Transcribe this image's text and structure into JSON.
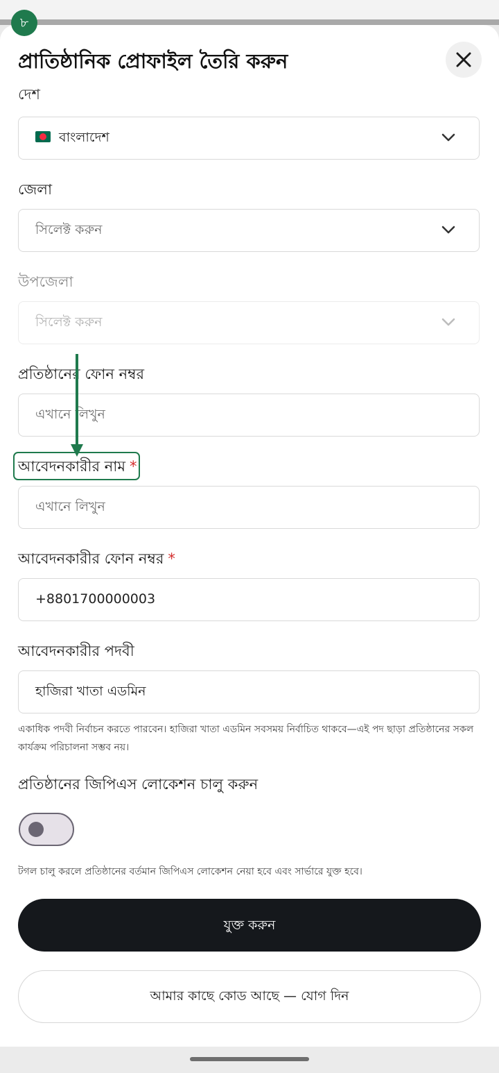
{
  "step_badge": "৮",
  "header": {
    "title": "প্রাতিষ্ঠানিক প্রোফাইল তৈরি করুন",
    "close_icon": "close-icon"
  },
  "country": {
    "clipped_label": "দেশ",
    "value": "বাংলাদেশ",
    "flag": "bangladesh-flag-icon"
  },
  "district": {
    "label": "জেলা",
    "placeholder": "সিলেক্ট করুন"
  },
  "upazila": {
    "label": "উপজেলা",
    "placeholder": "সিলেক্ট করুন"
  },
  "org_phone": {
    "label": "প্রতিষ্ঠানের ফোন নম্বর",
    "placeholder": "এখানে লিখুন"
  },
  "applicant_name": {
    "label": "আবেদনকারীর নাম",
    "required": "*",
    "placeholder": "এখানে লিখুন"
  },
  "applicant_phone": {
    "label": "আবেদনকারীর ফোন নম্বর",
    "required": "*",
    "value": "+8801700000003"
  },
  "applicant_designation": {
    "label": "আবেদনকারীর পদবী",
    "value": "হাজিরা খাতা এডমিন",
    "helper": "একাধিক পদবী নির্বাচন করতে পারবেন। হাজিরা খাতা এডমিন সবসময় নির্বাচিত থাকবে—এই পদ ছাড়া প্রতিষ্ঠানের সকল কার্যক্রম পরিচালনা সম্ভব নয়।"
  },
  "gps": {
    "label": "প্রতিষ্ঠানের জিপিএস লোকেশন চালু করুন",
    "enabled": false,
    "helper": "টগল চালু করলে প্রতিষ্ঠানের বর্তমান জিপিএস লোকেশন নেয়া হবে এবং সার্ভারে যুক্ত হবে।"
  },
  "buttons": {
    "primary": "যুক্ত করুন",
    "secondary": "আমার কাছে কোড আছে — যোগ দিন"
  },
  "colors": {
    "accent_green": "#1f7a4d",
    "primary_button": "#15181c",
    "required": "#d32f2f"
  }
}
